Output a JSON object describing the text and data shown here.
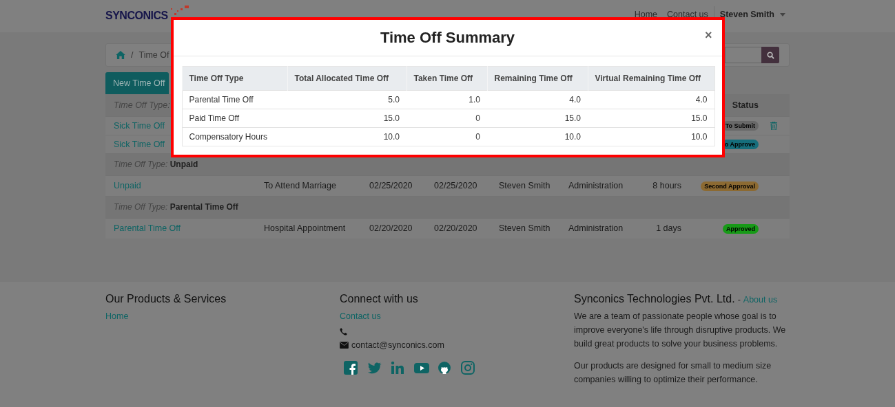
{
  "navbar": {
    "logo": "SYNCONICS",
    "links": [
      {
        "label": "Home"
      },
      {
        "label": "Contact us"
      }
    ],
    "user": "Steven Smith"
  },
  "breadcrumb": {
    "separator": "/",
    "current": "Time Of"
  },
  "new_button": "New Time Off",
  "table": {
    "header": {
      "group_label": "Time Off Type:",
      "status": "Status"
    },
    "rows": [
      {
        "kind": "item",
        "name": "Sick Time Off",
        "status": {
          "label": "To Submit",
          "color": "#686868"
        },
        "deletable": true
      },
      {
        "kind": "item",
        "name": "Sick Time Off",
        "status": {
          "label": "o Approve",
          "color": "#166e7c"
        },
        "deletable": false
      },
      {
        "kind": "group",
        "prefix": "Time Off Type:",
        "label": "Unpaid"
      },
      {
        "kind": "item",
        "name": "Unpaid",
        "description": "To Attend Marriage",
        "date_from": "02/25/2020",
        "date_to": "02/25/2020",
        "employee": "Steven Smith",
        "department": "Administration",
        "duration": "8 hours",
        "status": {
          "label": "Second Approval",
          "color": "#8c6a32"
        },
        "deletable": false
      },
      {
        "kind": "group",
        "prefix": "Time Off Type:",
        "label": "Parental Time Off"
      },
      {
        "kind": "item",
        "name": "Parental Time Off",
        "description": "Hospital Appointment",
        "date_from": "02/20/2020",
        "date_to": "02/20/2020",
        "employee": "Steven Smith",
        "department": "Administration",
        "duration": "1 days",
        "status": {
          "label": "Approved",
          "color": "#179a17"
        },
        "deletable": false
      }
    ]
  },
  "modal": {
    "title": "Time Off Summary",
    "close": "×",
    "columns": [
      "Time Off Type",
      "Total Allocated Time Off",
      "Taken Time Off",
      "Remaining Time Off",
      "Virtual Remaining Time Off"
    ],
    "rows": [
      [
        "Parental Time Off",
        "5.0",
        "1.0",
        "4.0",
        "4.0"
      ],
      [
        "Paid Time Off",
        "15.0",
        "0",
        "15.0",
        "15.0"
      ],
      [
        "Compensatory Hours",
        "10.0",
        "0",
        "10.0",
        "10.0"
      ]
    ]
  },
  "footer": {
    "products": {
      "heading": "Our Products & Services",
      "links": [
        "Home"
      ]
    },
    "connect": {
      "heading": "Connect with us",
      "link": "Contact us",
      "email": "contact@synconics.com"
    },
    "company": {
      "heading": "Synconics Technologies Pvt. Ltd.",
      "separator": "-",
      "link": "About us",
      "paragraphs": [
        "We are a team of passionate people whose goal is to improve everyone's life through disruptive products. We build great products to solve your business problems.",
        "Our products are designed for small to medium size companies willing to optimize their performance."
      ]
    }
  }
}
